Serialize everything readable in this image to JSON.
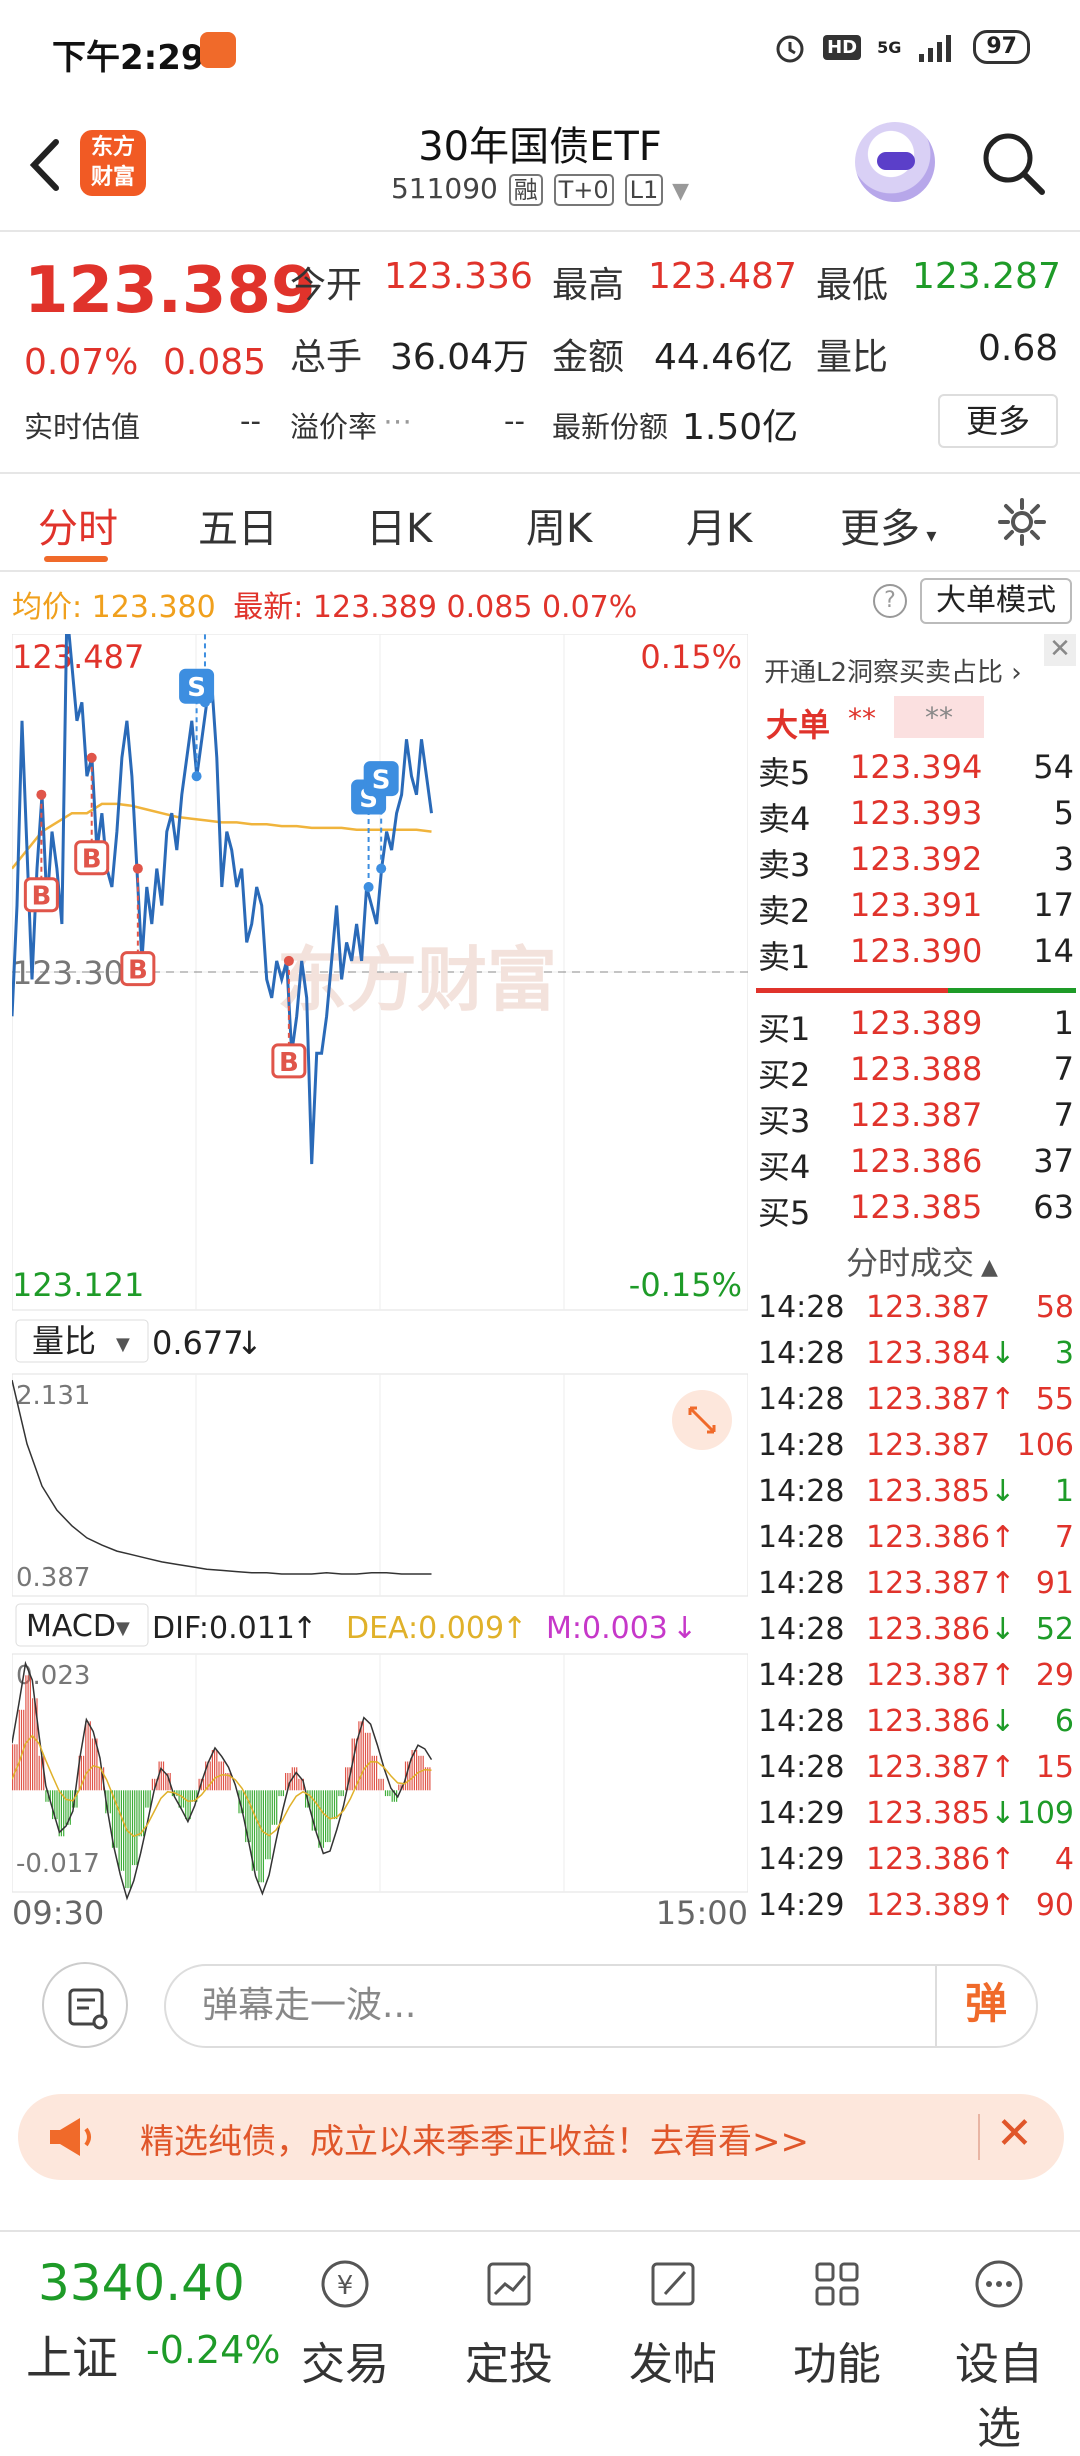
{
  "status_bar": {
    "time": "下午2:29",
    "network": "5G",
    "hd": "HD",
    "battery": "97"
  },
  "header": {
    "logo_line1": "东方",
    "logo_line2": "财富",
    "title": "30年国债ETF",
    "code": "511090",
    "tags": [
      "融",
      "T+0",
      "L1"
    ]
  },
  "quote": {
    "price": "123.389",
    "pct": "0.07%",
    "change": "0.085",
    "open_label": "今开",
    "open": "123.336",
    "high_label": "最高",
    "high": "123.487",
    "low_label": "最低",
    "low": "123.287",
    "volume_label": "总手",
    "volume": "36.04万",
    "amount_label": "金额",
    "amount": "44.46亿",
    "ratio_label": "量比",
    "ratio": "0.68",
    "est_label": "实时估值",
    "est": "--",
    "premium_label": "溢价率",
    "premium": "--",
    "shares_label": "最新份额",
    "shares": "1.50亿",
    "more": "更多"
  },
  "tabs": [
    "分时",
    "五日",
    "日K",
    "周K",
    "月K",
    "更多"
  ],
  "info_line": {
    "avg_label": "均价:",
    "avg": "123.380",
    "latest_label": "最新:",
    "latest": "123.389",
    "chg": "0.085",
    "pct": "0.07%"
  },
  "big_order_button": "大单模式",
  "chart_data": {
    "type": "line",
    "price_axis": {
      "top": "123.487",
      "bottom": "123.121",
      "ref": "123.304",
      "top_pct": "0.15%",
      "bottom_pct": "-0.15%"
    },
    "time_axis": {
      "start": "09:30",
      "end": "15:00"
    },
    "price_series": [
      123.28,
      123.34,
      123.44,
      123.37,
      123.3,
      123.36,
      123.4,
      123.34,
      123.38,
      123.36,
      123.33,
      123.5,
      123.47,
      123.44,
      123.45,
      123.41,
      123.42,
      123.37,
      123.39,
      123.36,
      123.35,
      123.38,
      123.42,
      123.44,
      123.41,
      123.36,
      123.31,
      123.35,
      123.33,
      123.36,
      123.34,
      123.38,
      123.39,
      123.37,
      123.4,
      123.42,
      123.44,
      123.41,
      123.43,
      123.45,
      123.46,
      123.42,
      123.35,
      123.38,
      123.37,
      123.35,
      123.36,
      123.32,
      123.33,
      123.35,
      123.34,
      123.3,
      123.29,
      123.31,
      123.3,
      123.31,
      123.26,
      123.28,
      123.31,
      123.29,
      123.2,
      123.26,
      123.26,
      123.28,
      123.31,
      123.34,
      123.3,
      123.32,
      123.31,
      123.33,
      123.31,
      123.35,
      123.34,
      123.33,
      123.36,
      123.38,
      123.37,
      123.39,
      123.4,
      123.43,
      123.41,
      123.4,
      123.43,
      123.41,
      123.39
    ],
    "avg_series": [
      123.36,
      123.37,
      123.38,
      123.385,
      123.39,
      123.39,
      123.395,
      123.395,
      123.394,
      123.392,
      123.39,
      123.388,
      123.387,
      123.386,
      123.385,
      123.385,
      123.384,
      123.384,
      123.383,
      123.383,
      123.382,
      123.382,
      123.382,
      123.381,
      123.381,
      123.381,
      123.381,
      123.381,
      123.38
    ],
    "markers": [
      {
        "type": "B",
        "t": 0.07
      },
      {
        "type": "B",
        "t": 0.19
      },
      {
        "type": "B",
        "t": 0.3
      },
      {
        "type": "B",
        "t": 0.66
      },
      {
        "type": "S",
        "t": 0.13
      },
      {
        "type": "S",
        "t": 0.44
      },
      {
        "type": "S",
        "t": 0.46
      },
      {
        "type": "S",
        "t": 0.85
      },
      {
        "type": "S",
        "t": 0.88
      }
    ],
    "volume_ratio": {
      "label": "量比",
      "value": "0.677",
      "max": "2.131",
      "min": "0.387",
      "series": [
        2.13,
        1.6,
        1.25,
        1.05,
        0.92,
        0.82,
        0.76,
        0.71,
        0.68,
        0.65,
        0.62,
        0.6,
        0.58,
        0.56,
        0.55,
        0.54,
        0.53,
        0.53,
        0.52,
        0.52,
        0.52,
        0.53,
        0.52,
        0.52,
        0.53,
        0.53,
        0.52,
        0.52,
        0.52
      ]
    },
    "macd": {
      "label": "MACD",
      "dif": "DIF:0.011",
      "dea": "DEA:0.009",
      "m": "M:0.003",
      "max": "0.023",
      "min": "-0.017",
      "hist": [
        8,
        14,
        20,
        16,
        6,
        -2,
        -5,
        -8,
        -6,
        -3,
        6,
        12,
        9,
        4,
        -4,
        -10,
        -14,
        -17,
        -13,
        -8,
        -3,
        2,
        5,
        3,
        -1,
        -3,
        -5,
        -2,
        2,
        5,
        7,
        5,
        3,
        0,
        -4,
        -9,
        -14,
        -16,
        -12,
        -6,
        -1,
        3,
        4,
        2,
        -3,
        -7,
        -10,
        -9,
        -5,
        -1,
        4,
        9,
        12,
        10,
        6,
        2,
        -1,
        -2,
        1,
        5,
        7,
        6,
        4
      ]
    },
    "l2_panel": {
      "header": "开通L2洞察买卖占比",
      "big_label": "大单",
      "stars1": "**",
      "stars2": "**"
    }
  },
  "order_book": {
    "asks": [
      {
        "label": "卖5",
        "price": "123.394",
        "vol": "54"
      },
      {
        "label": "卖4",
        "price": "123.393",
        "vol": "5"
      },
      {
        "label": "卖3",
        "price": "123.392",
        "vol": "3"
      },
      {
        "label": "卖2",
        "price": "123.391",
        "vol": "17"
      },
      {
        "label": "卖1",
        "price": "123.390",
        "vol": "14"
      }
    ],
    "bids": [
      {
        "label": "买1",
        "price": "123.389",
        "vol": "1"
      },
      {
        "label": "买2",
        "price": "123.388",
        "vol": "7"
      },
      {
        "label": "买3",
        "price": "123.387",
        "vol": "7"
      },
      {
        "label": "买4",
        "price": "123.386",
        "vol": "37"
      },
      {
        "label": "买5",
        "price": "123.385",
        "vol": "63"
      }
    ]
  },
  "trades_header": "分时成交",
  "trades": [
    {
      "time": "14:28",
      "price": "123.387",
      "arrow": "",
      "vol": "58",
      "dir": "up"
    },
    {
      "time": "14:28",
      "price": "123.384",
      "arrow": "↓",
      "vol": "3",
      "dir": "down"
    },
    {
      "time": "14:28",
      "price": "123.387",
      "arrow": "↑",
      "vol": "55",
      "dir": "up"
    },
    {
      "time": "14:28",
      "price": "123.387",
      "arrow": "",
      "vol": "106",
      "dir": "up"
    },
    {
      "time": "14:28",
      "price": "123.385",
      "arrow": "↓",
      "vol": "1",
      "dir": "down"
    },
    {
      "time": "14:28",
      "price": "123.386",
      "arrow": "↑",
      "vol": "7",
      "dir": "up"
    },
    {
      "time": "14:28",
      "price": "123.387",
      "arrow": "↑",
      "vol": "91",
      "dir": "up"
    },
    {
      "time": "14:28",
      "price": "123.386",
      "arrow": "↓",
      "vol": "52",
      "dir": "down"
    },
    {
      "time": "14:28",
      "price": "123.387",
      "arrow": "↑",
      "vol": "29",
      "dir": "up"
    },
    {
      "time": "14:28",
      "price": "123.386",
      "arrow": "↓",
      "vol": "6",
      "dir": "down"
    },
    {
      "time": "14:28",
      "price": "123.387",
      "arrow": "↑",
      "vol": "15",
      "dir": "up"
    },
    {
      "time": "14:29",
      "price": "123.385",
      "arrow": "↓",
      "vol": "109",
      "dir": "down"
    },
    {
      "time": "14:29",
      "price": "123.386",
      "arrow": "↑",
      "vol": "4",
      "dir": "up"
    },
    {
      "time": "14:29",
      "price": "123.389",
      "arrow": "↑",
      "vol": "90",
      "dir": "up"
    }
  ],
  "comment": {
    "placeholder": "弹幕走一波...",
    "dan": "弹"
  },
  "banner": {
    "text": "精选纯债，成立以来季季正收益！去看看>>"
  },
  "bottom_nav": {
    "index_value": "3340.40",
    "index_name": "上证",
    "index_pct": "-0.24%",
    "items": [
      "交易",
      "定投",
      "发帖",
      "功能",
      "设自选"
    ]
  },
  "colors": {
    "up": "#e0332b",
    "down": "#1e9b28",
    "price_line": "#2a6ab8",
    "avg_line": "#f0b43c",
    "accent": "#f06a2a"
  }
}
